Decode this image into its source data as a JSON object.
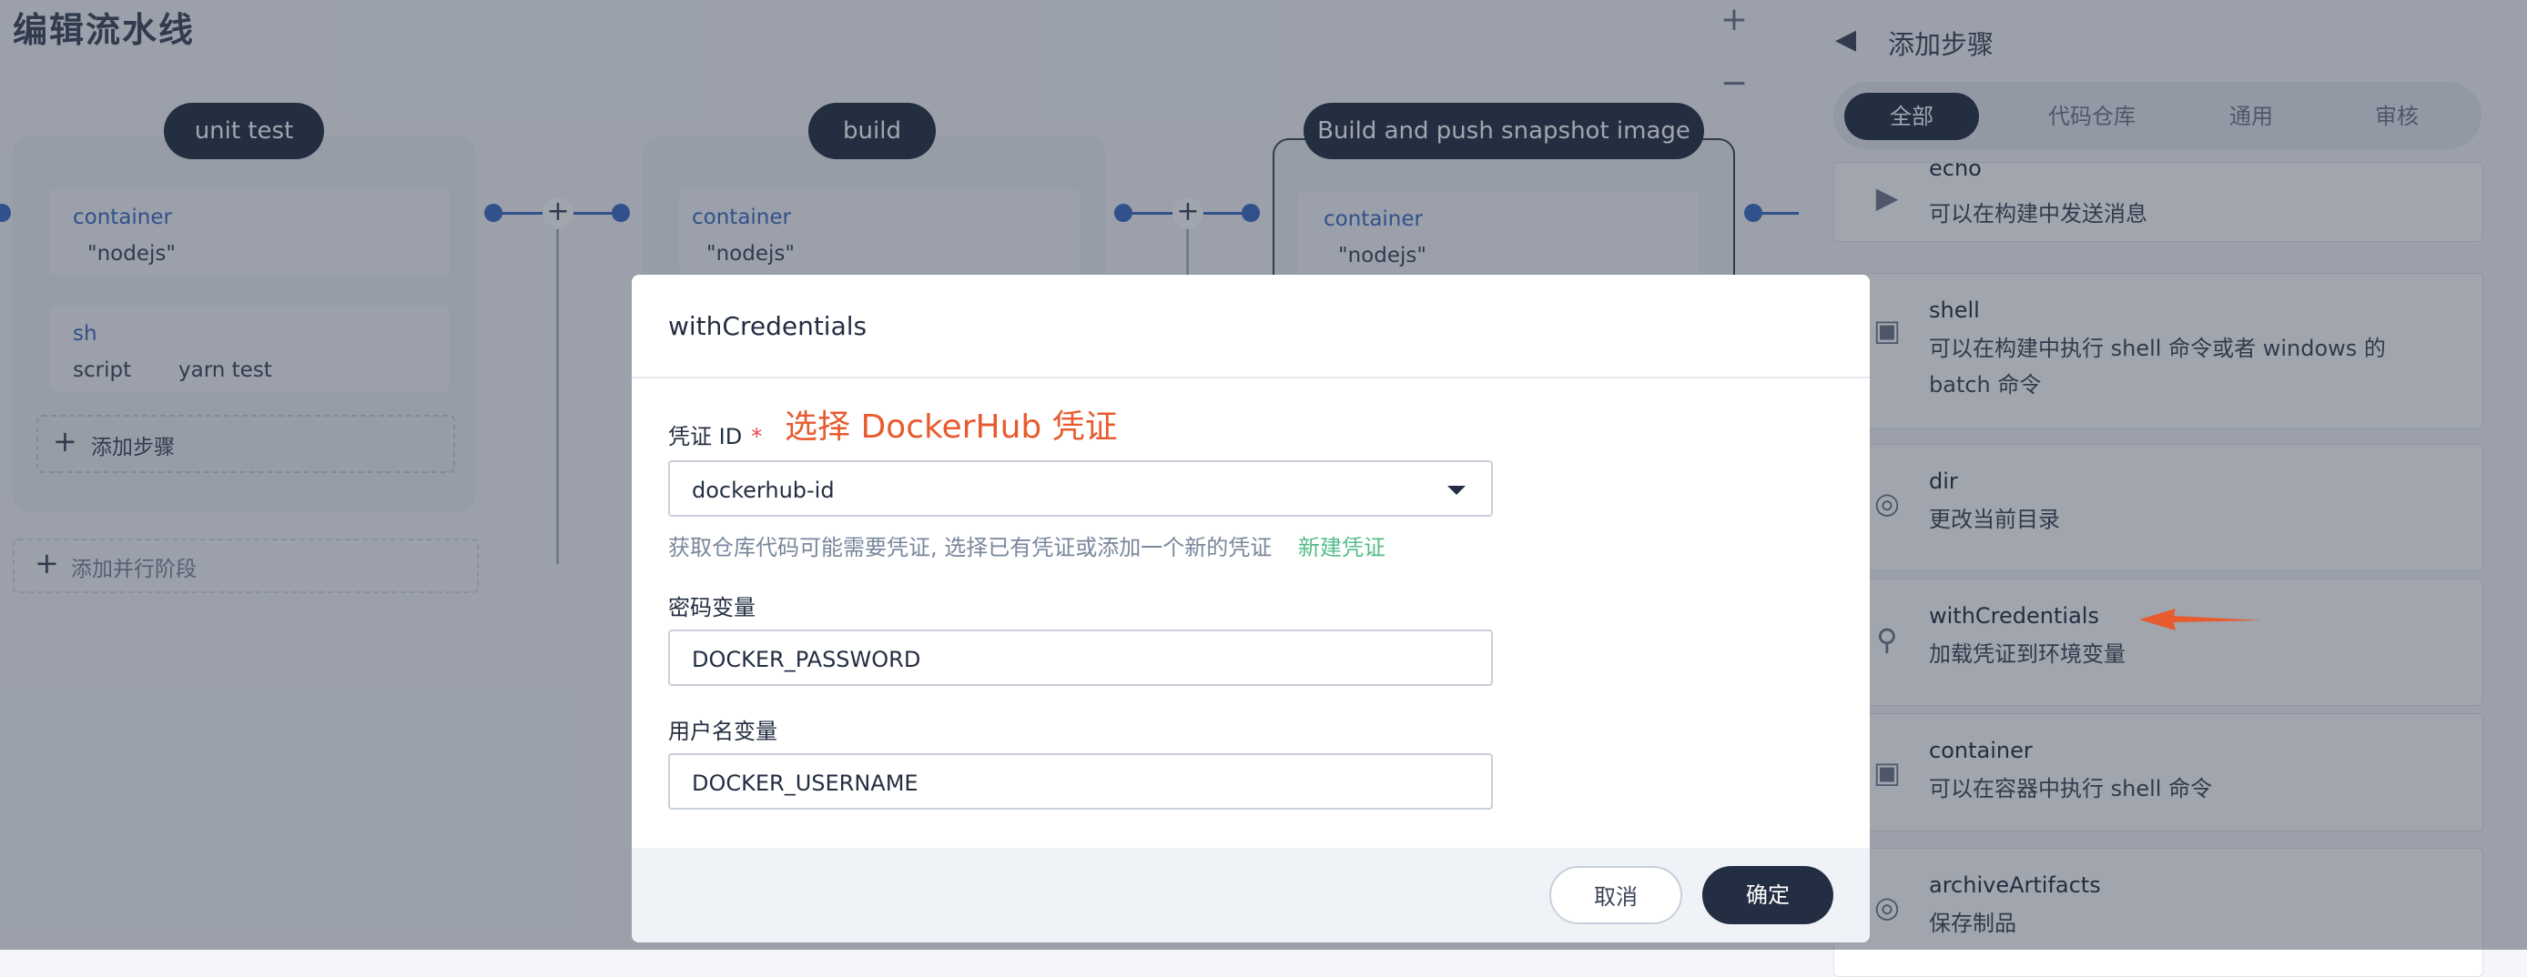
{
  "page": {
    "title": "编辑流水线"
  },
  "zoom": {
    "in": "+",
    "out": "−"
  },
  "pipeline": {
    "stages": [
      {
        "name": "unit test",
        "steps": [
          {
            "type": "container",
            "value": "\"nodejs\""
          },
          {
            "type": "sh",
            "key": "script",
            "value": "yarn test"
          }
        ],
        "add_step": "添加步骤"
      },
      {
        "name": "build",
        "steps": [
          {
            "type": "container",
            "value": "\"nodejs\""
          }
        ]
      },
      {
        "name": "Build and push snapshot image",
        "steps": [
          {
            "type": "container",
            "value": "\"nodejs\""
          }
        ]
      }
    ],
    "add_parallel": "添加并行阶段",
    "plus": "+"
  },
  "panel": {
    "back_icon": "back-arrow-icon",
    "title": "添加步骤",
    "tabs": [
      "全部",
      "代码仓库",
      "通用",
      "审核"
    ],
    "active_tab": "全部",
    "steps": [
      {
        "name": "echo",
        "desc": "可以在构建中发送消息",
        "icon": "megaphone-icon"
      },
      {
        "name": "shell",
        "desc": "可以在构建中执行 shell 命令或者 windows 的 batch 命令",
        "icon": "terminal-icon"
      },
      {
        "name": "dir",
        "desc": "更改当前目录",
        "icon": "target-icon"
      },
      {
        "name": "withCredentials",
        "desc": "加载凭证到环境变量",
        "icon": "key-icon"
      },
      {
        "name": "container",
        "desc": "可以在容器中执行 shell 命令",
        "icon": "terminal-icon"
      },
      {
        "name": "archiveArtifacts",
        "desc": "保存制品",
        "icon": "target-icon"
      }
    ]
  },
  "modal": {
    "title": "withCredentials",
    "credential_label": "凭证 ID",
    "required_mark": "*",
    "annotation": "选择 DockerHub 凭证",
    "credential_value": "dockerhub-id",
    "hint": "获取仓库代码可能需要凭证, 选择已有凭证或添加一个新的凭证",
    "new_credential": "新建凭证",
    "password_label": "密码变量",
    "password_value": "DOCKER_PASSWORD",
    "username_label": "用户名变量",
    "username_value": "DOCKER_USERNAME",
    "cancel": "取消",
    "ok": "确定"
  },
  "colors": {
    "accent": "#242e42",
    "link": "#3a6cc5",
    "success": "#55bc8a",
    "annotation": "#e85b2e",
    "required": "#e5484d"
  }
}
